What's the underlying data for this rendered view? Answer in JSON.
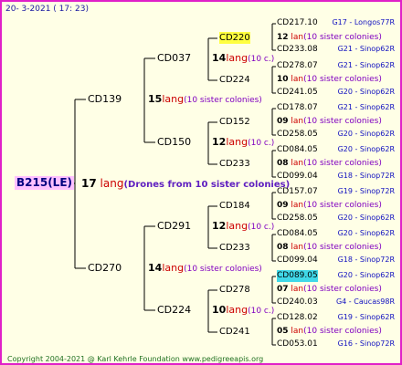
{
  "header": "20-  3-2021 ( 17: 23)",
  "footer": "Copyright 2004-2021 @ Karl Kehrle Foundation    www.pedigreeapis.org",
  "colors": {
    "border": "#e020c8",
    "background": "#ffffe6",
    "root_highlight": "#ffc0ff",
    "yellow_highlight": "#ffff40",
    "cyan_highlight": "#40d8e8"
  },
  "root": {
    "name": "B215(LE)",
    "num": "17",
    "lang": "lang",
    "sisters": "(Drones from 10 sister colonies)"
  },
  "g1": [
    {
      "name": "CD139",
      "num": "15",
      "lang": "lang",
      "sisters": "(10 sister colonies)"
    },
    {
      "name": "CD270",
      "num": "14",
      "lang": "lang",
      "sisters": "(10 sister colonies)"
    }
  ],
  "g2": [
    {
      "name": "CD037",
      "num": "14",
      "lang": "lang",
      "sisters": "(10 c.)"
    },
    {
      "name": "CD150",
      "num": "12",
      "lang": "lang",
      "sisters": "(10 c.)"
    },
    {
      "name": "CD291",
      "num": "12",
      "lang": "lang",
      "sisters": "(10 c.)"
    },
    {
      "name": "CD224",
      "num": "10",
      "lang": "lang",
      "sisters": "(10 c.)"
    }
  ],
  "g3": [
    {
      "name": "CD220",
      "num": "12",
      "lang": "lan",
      "sisters": "(10 sister colonies)"
    },
    {
      "name": "CD224",
      "num": "10",
      "lang": "lan",
      "sisters": "(10 sister colonies)"
    },
    {
      "name": "CD152",
      "num": "09",
      "lang": "lan",
      "sisters": "(10 sister colonies)"
    },
    {
      "name": "CD233",
      "num": "08",
      "lang": "lan",
      "sisters": "(10 sister colonies)"
    },
    {
      "name": "CD184",
      "num": "09",
      "lang": "lan",
      "sisters": "(10 sister colonies)"
    },
    {
      "name": "CD233",
      "num": "08",
      "lang": "lan",
      "sisters": "(10 sister colonies)"
    },
    {
      "name": "CD278",
      "num": "07",
      "lang": "lan",
      "sisters": "(10 sister colonies)"
    },
    {
      "name": "CD241",
      "num": "05",
      "lang": "lan",
      "sisters": "(10 sister colonies)"
    }
  ],
  "g4": [
    {
      "name": "CD217.10",
      "src": "G17 - Longos77R"
    },
    {
      "name": "CD233.08",
      "src": "G21 - Sinop62R"
    },
    {
      "name": "CD278.07",
      "src": "G21 - Sinop62R"
    },
    {
      "name": "CD241.05",
      "src": "G20 - Sinop62R"
    },
    {
      "name": "CD178.07",
      "src": "G21 - Sinop62R"
    },
    {
      "name": "CD258.05",
      "src": "G20 - Sinop62R"
    },
    {
      "name": "CD084.05",
      "src": "G20 - Sinop62R"
    },
    {
      "name": "CD099.04",
      "src": "G18 - Sinop72R"
    },
    {
      "name": "CD157.07",
      "src": "G19 - Sinop72R"
    },
    {
      "name": "CD258.05",
      "src": "G20 - Sinop62R"
    },
    {
      "name": "CD084.05",
      "src": "G20 - Sinop62R"
    },
    {
      "name": "CD099.04",
      "src": "G18 - Sinop72R"
    },
    {
      "name": "CD089.05",
      "src": "G20 - Sinop62R"
    },
    {
      "name": "CD240.03",
      "src": "G4 - Caucas98R"
    },
    {
      "name": "CD128.02",
      "src": "G19 - Sinop62R"
    },
    {
      "name": "CD053.01",
      "src": "G16 - Sinop72R"
    }
  ]
}
